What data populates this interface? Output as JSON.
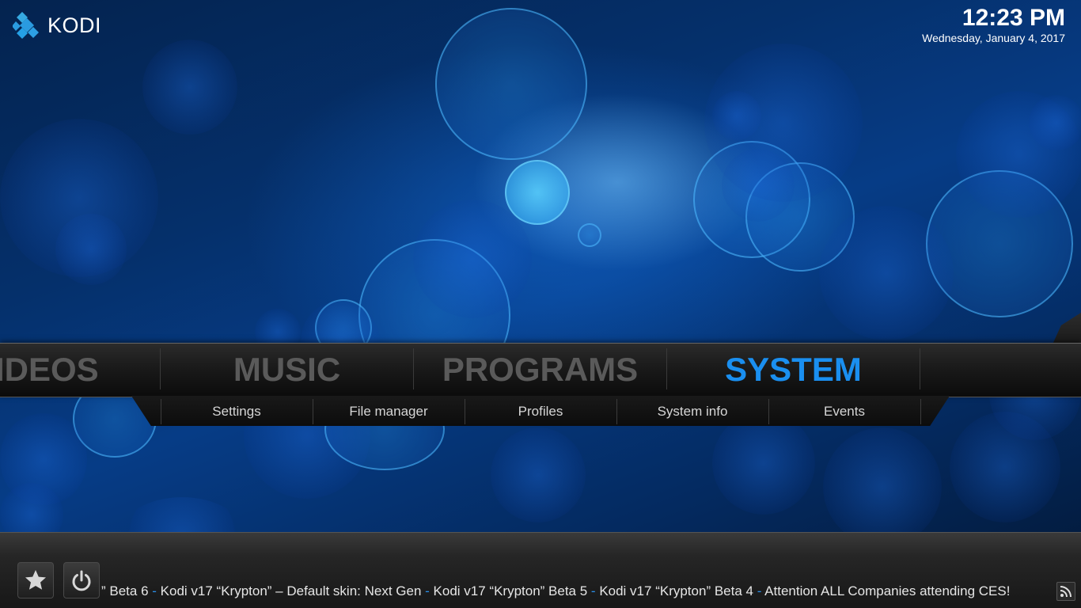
{
  "app": {
    "name": "KODI"
  },
  "clock": {
    "time": "12:23 PM",
    "date": "Wednesday, January 4, 2017"
  },
  "main_menu": {
    "items": [
      {
        "label": "IDEOS",
        "active": false
      },
      {
        "label": "MUSIC",
        "active": false
      },
      {
        "label": "PROGRAMS",
        "active": false
      },
      {
        "label": "SYSTEM",
        "active": true
      }
    ]
  },
  "submenu": {
    "items": [
      {
        "label": "Settings"
      },
      {
        "label": "File manager"
      },
      {
        "label": "Profiles"
      },
      {
        "label": "System info"
      },
      {
        "label": "Events"
      }
    ]
  },
  "bottom_bar": {
    "favourites_icon": "star-icon",
    "power_icon": "power-icon",
    "rss_icon": "rss-icon",
    "ticker": [
      "” Beta 6",
      "Kodi v17 “Krypton” – Default skin: Next Gen",
      "Kodi v17 “Krypton” Beta 5",
      "Kodi v17 “Krypton” Beta 4",
      "Attention ALL Companies attending CES!"
    ],
    "ticker_separator": " - "
  },
  "colors": {
    "accent": "#1a8ff0",
    "inactive_menu": "#5a5a5a",
    "background": "#063c86"
  }
}
